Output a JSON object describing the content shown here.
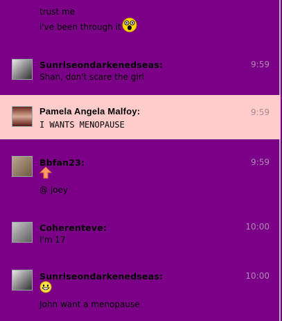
{
  "top_fragment": {
    "line1": "trust me",
    "line2": "i've been through it"
  },
  "messages": [
    {
      "name": "Sunriseondarkenedseas:",
      "time": "9:59",
      "text": "Shan, don't scare the girl"
    },
    {
      "name": "Pamela Angela Malfoy:",
      "time": "9:59",
      "text": "I WANTS MENOPAUSE"
    },
    {
      "name": "Bbfan23:",
      "time": "9:59",
      "text": "@ joey"
    },
    {
      "name": "Coherenteve:",
      "time": "10:00",
      "text": "I'm 17"
    },
    {
      "name": "Sunriseondarkenedseas:",
      "time": "10:00",
      "text": "John want a menopause"
    }
  ],
  "colors": {
    "background": "#7b0087",
    "highlight": "#ffcccc"
  }
}
